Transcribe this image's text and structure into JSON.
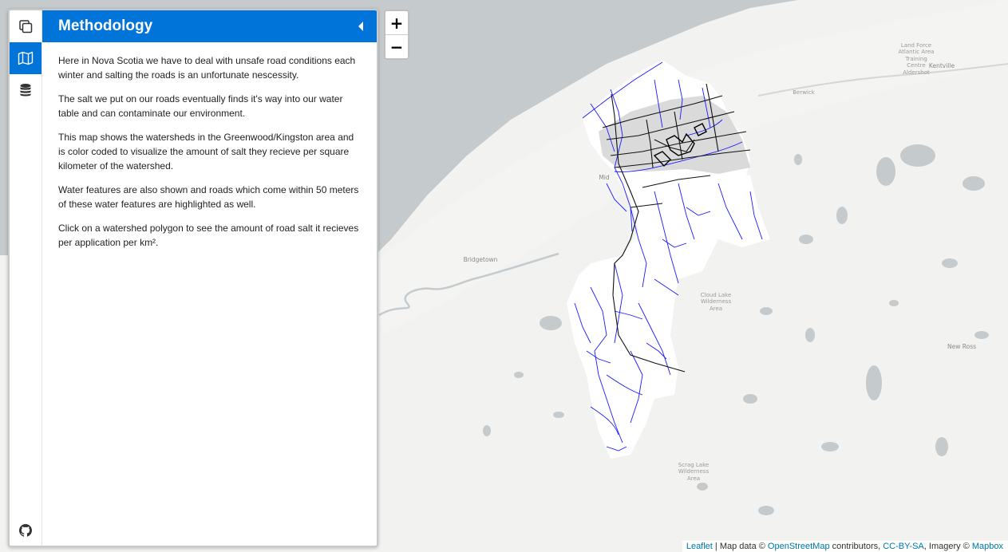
{
  "sidebar": {
    "tabs": [
      {
        "name": "layers-tab",
        "icon": "layers-icon",
        "active": false
      },
      {
        "name": "map-tab",
        "icon": "map-icon",
        "active": true
      },
      {
        "name": "database-tab",
        "icon": "database-icon",
        "active": false
      }
    ],
    "bottom_tab": {
      "name": "github-tab",
      "icon": "github-icon"
    },
    "pane": {
      "title": "Methodology",
      "close_icon": "caret-left-icon",
      "paragraphs": [
        "Here in Nova Scotia we have to deal with unsafe road conditions each winter and salting the roads is an unfortunate nescessity.",
        "The salt we put on our roads eventually finds it's way into our water table and can contaminate our environment.",
        "This map shows the watersheds in the Greenwood/Kingston area and is color coded to visualize the amount of salt they recieve per square kilometer of the watershed.",
        "Water features are also shown and roads which come within 50 meters of these water features are highlighted as well.",
        "Click on a watershed polygon to see the amount of road salt it recieves per application per km²."
      ]
    },
    "accent_color": "#0074d9"
  },
  "zoom": {
    "in_label": "+",
    "out_label": "−"
  },
  "map": {
    "places": {
      "land_force": "Land Force Atlantic Area Training Centre Aldershot",
      "kentville": "Kentville",
      "berwick": "Berwick",
      "bridgetown": "Bridgetown",
      "cloud_lake": "Cloud Lake Wilderness Area",
      "new_ross": "New Ross",
      "middleton": "Mid",
      "scrag_lake": "Scrag Lake Wilderness Area"
    },
    "water_color": "#c5cbcd",
    "stream_color": "#1a1aff",
    "road_color": "#111111"
  },
  "attribution": {
    "leaflet": "Leaflet",
    "sep1": " | Map data © ",
    "osm": "OpenStreetMap",
    "sep2": " contributors, ",
    "license": "CC-BY-SA",
    "sep3": ", Imagery © ",
    "mapbox": "Mapbox"
  }
}
